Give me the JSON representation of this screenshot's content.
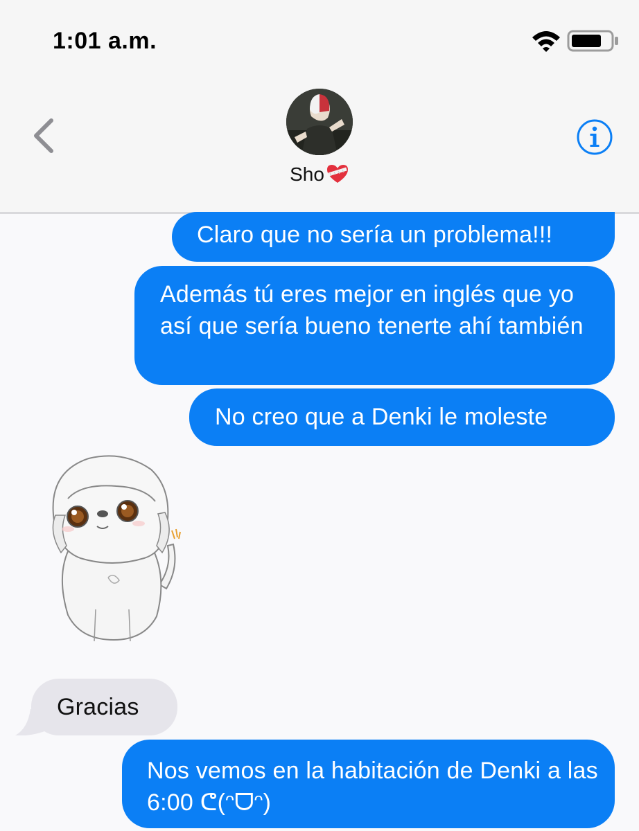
{
  "status_bar": {
    "time": "1:01 a.m.",
    "wifi_icon": "wifi-icon",
    "battery_icon": "battery-icon"
  },
  "header": {
    "back_icon": "chevron-left-icon",
    "contact_name": "Sho",
    "name_emoji": "mending-heart-icon",
    "info_icon": "info-icon"
  },
  "messages": [
    {
      "direction": "out",
      "text": "Claro que no sería un problema!!!"
    },
    {
      "direction": "out",
      "text": "Además tú eres mejor en inglés que yo así que sería bueno tenerte ahí también"
    },
    {
      "direction": "out",
      "text": "No creo que a Denki le moleste"
    },
    {
      "direction": "in",
      "sticker": "white-puppy-sticker"
    },
    {
      "direction": "in",
      "text": "Gracias"
    },
    {
      "direction": "out",
      "text": "Nos vemos en la habitación de Denki a las 6:00 ᕦ(ᵔᗜᵔ)"
    }
  ],
  "colors": {
    "outgoing_bubble": "#0b7ff5",
    "incoming_bubble": "#e6e5eb",
    "accent": "#0b7ff5",
    "background": "#f9f9fb"
  }
}
